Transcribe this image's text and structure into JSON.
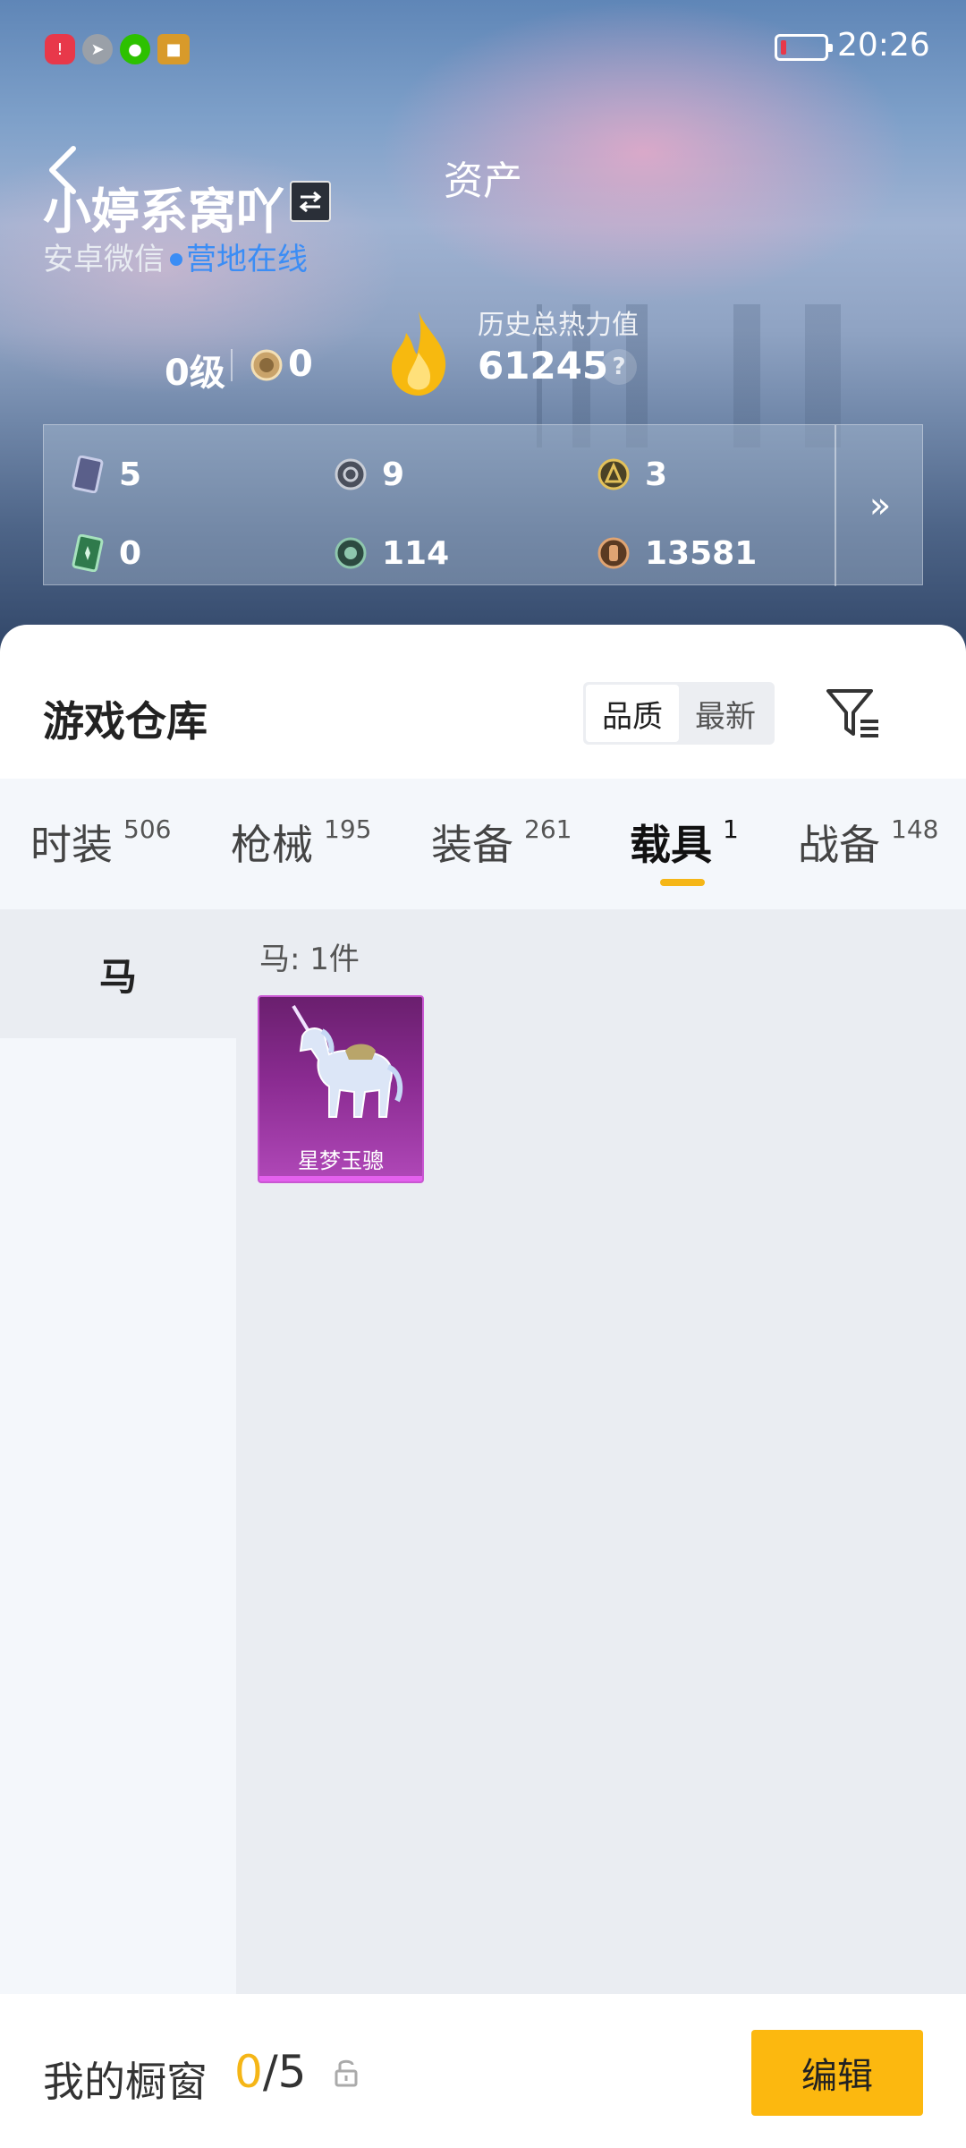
{
  "status_bar": {
    "time": "20:26"
  },
  "header": {
    "title": "资产",
    "username": "小婷系窝吖",
    "platform": "安卓微信",
    "online_status": "营地在线"
  },
  "profile": {
    "level": "0级",
    "medal_count": "0",
    "heat_label": "历史总热力值",
    "heat_value": "61245",
    "help": "?"
  },
  "resources": {
    "items": [
      {
        "icon": "card-icon",
        "value": "5"
      },
      {
        "icon": "coin-silver-icon",
        "value": "9"
      },
      {
        "icon": "coin-gold-icon",
        "value": "3"
      },
      {
        "icon": "ticket-icon",
        "value": "0"
      },
      {
        "icon": "coin-green-icon",
        "value": "114"
      },
      {
        "icon": "coin-bronze-icon",
        "value": "13581"
      }
    ],
    "more": "»"
  },
  "warehouse": {
    "title": "游戏仓库",
    "sort_options": [
      "品质",
      "最新"
    ],
    "active_sort": "品质"
  },
  "tabs": [
    {
      "label": "时装",
      "count": "506"
    },
    {
      "label": "枪械",
      "count": "195"
    },
    {
      "label": "装备",
      "count": "261"
    },
    {
      "label": "载具",
      "count": "1"
    },
    {
      "label": "战备",
      "count": "148"
    }
  ],
  "active_tab": "载具",
  "side_nav": {
    "items": [
      {
        "label": "马"
      }
    ]
  },
  "category": {
    "count_text": "马: 1件"
  },
  "items": [
    {
      "name": "星梦玉骢"
    }
  ],
  "bottom_bar": {
    "showcase_label": "我的橱窗",
    "showcase_current": "0",
    "showcase_total": "/5",
    "edit_label": "编辑"
  },
  "colors": {
    "accent": "#fcb80f",
    "online": "#3b8df5",
    "item_rarity": "#b048b8"
  }
}
